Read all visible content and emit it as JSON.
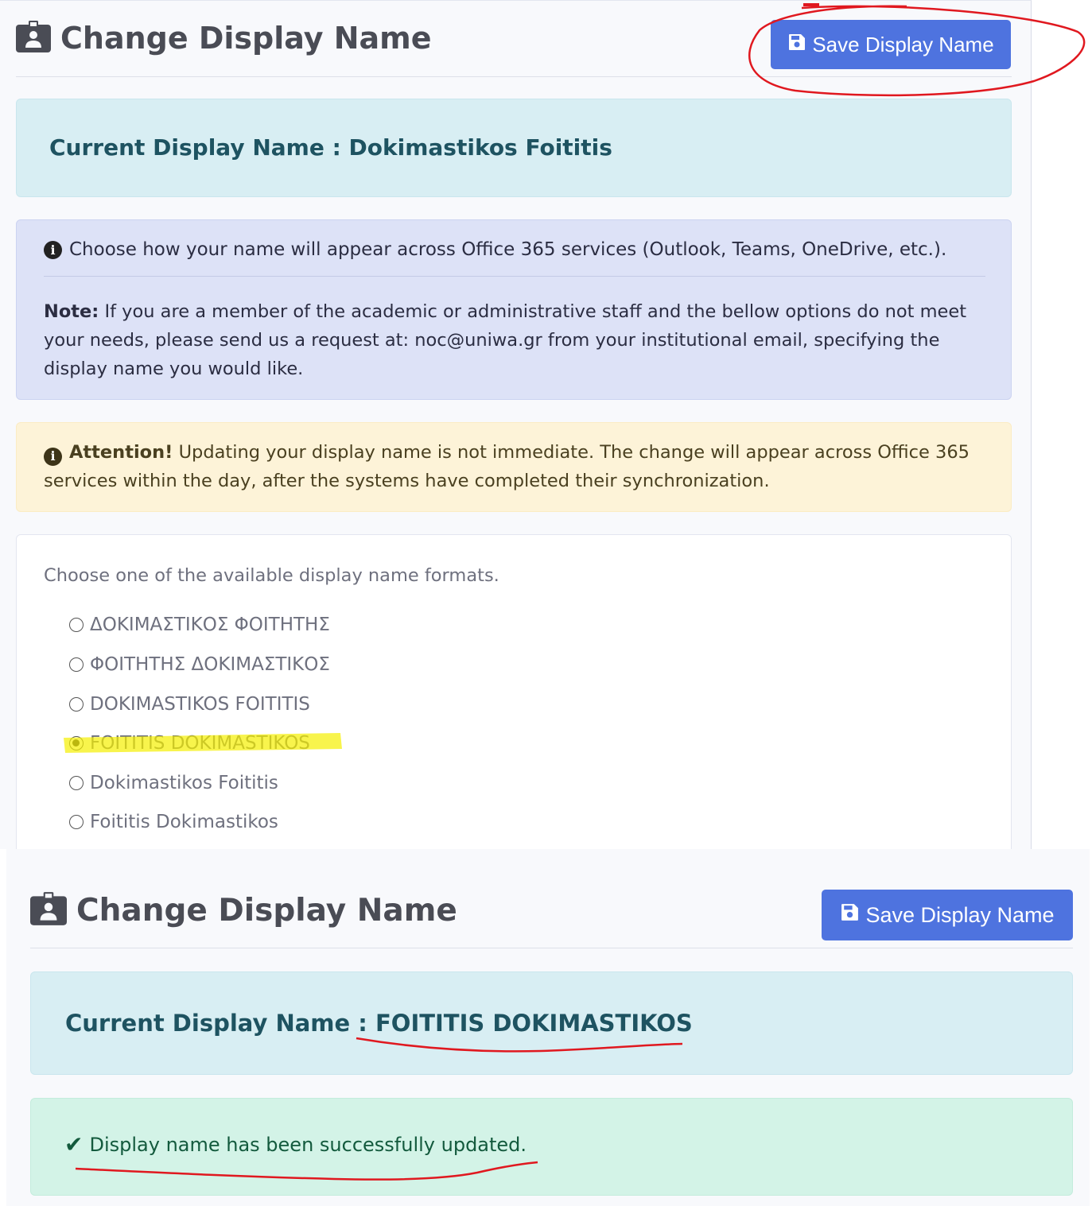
{
  "before": {
    "title": "Change Display Name",
    "save_button": "Save Display Name",
    "current": {
      "label": "Current Display Name :",
      "value": "Dokimastikos Foititis"
    },
    "info": {
      "line": "Choose how your name will appear across Office 365 services (Outlook, Teams, OneDrive, etc.).",
      "note_label": "Note:",
      "note_text": "If you are a member of the academic or administrative staff and the bellow options do not meet your needs, please send us a request at: noc@uniwa.gr from your institutional email, specifying the display name you would like."
    },
    "warning": {
      "label": "Attention!",
      "text": "Updating your display name is not immediate. The change will appear across Office 365 services within the day, after the systems have completed their synchronization."
    },
    "options_label": "Choose one of the available display name formats.",
    "options": [
      {
        "label": "ΔΟΚΙΜΑΣΤΙΚΟΣ ΦΟΙΤΗΤΗΣ",
        "checked": false
      },
      {
        "label": "ΦΟΙΤΗΤΗΣ ΔΟΚΙΜΑΣΤΙΚΟΣ",
        "checked": false
      },
      {
        "label": "DOKIMASTIKOS FOITITIS",
        "checked": false
      },
      {
        "label": "FOITITIS DOKIMASTIKOS",
        "checked": true
      },
      {
        "label": "Dokimastikos Foititis",
        "checked": false
      },
      {
        "label": "Foititis Dokimastikos",
        "checked": false
      }
    ]
  },
  "after": {
    "title": "Change Display Name",
    "save_button": "Save Display Name",
    "current": {
      "label": "Current Display Name :",
      "value": "FOITITIS DOKIMASTIKOS"
    },
    "success": "Display name has been successfully updated."
  },
  "colors": {
    "primary": "#4e73df",
    "annotation_red": "#e0181f",
    "highlight_yellow": "#f5f000"
  },
  "icons": {
    "title": "id-badge-icon",
    "save": "floppy-disk-icon",
    "info": "info-circle-icon",
    "success": "check-icon"
  }
}
